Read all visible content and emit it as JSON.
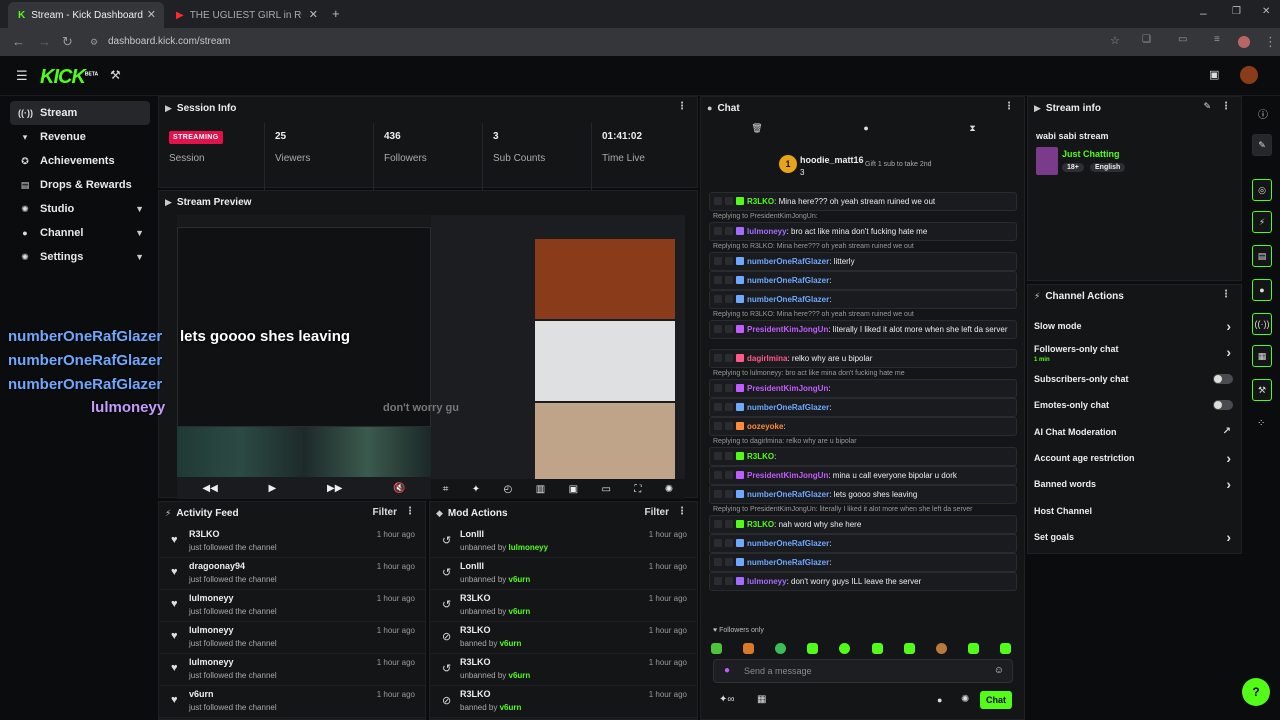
{
  "browser": {
    "tabs": [
      {
        "label": "Stream - Kick Dashboard"
      },
      {
        "label": "THE UGLIEST GIRL in ROBLOX"
      }
    ],
    "url": "dashboard.kick.com/stream"
  },
  "brand": {
    "logo": "KICK",
    "beta": "BETA",
    "accent": "#53fc18"
  },
  "sidebar": {
    "items": [
      {
        "label": "Stream",
        "icon": "broadcast-icon"
      },
      {
        "label": "Revenue",
        "icon": "trophy-icon"
      },
      {
        "label": "Achievements",
        "icon": "award-icon"
      },
      {
        "label": "Drops & Rewards",
        "icon": "gift-icon"
      },
      {
        "label": "Studio",
        "icon": "gear-icon"
      },
      {
        "label": "Channel",
        "icon": "user-icon"
      },
      {
        "label": "Settings",
        "icon": "gear-icon"
      }
    ]
  },
  "session": {
    "title": "Session Info",
    "status": "STREAMING",
    "status_label": "Session",
    "stats": [
      {
        "value": "25",
        "label": "Viewers"
      },
      {
        "value": "436",
        "label": "Followers"
      },
      {
        "value": "3",
        "label": "Sub Counts"
      },
      {
        "value": "01:41:02",
        "label": "Time Live"
      }
    ]
  },
  "preview": {
    "title": "Stream Preview",
    "overlay_names": [
      "numberOneRafGlazer",
      "numberOneRafGlazer",
      "numberOneRafGlazer",
      "lulmoneyy"
    ],
    "overlay_msg": "lets goooo shes leaving",
    "overlay_msg2": "don't worry gu"
  },
  "activity": {
    "title": "Activity Feed",
    "filter": "Filter",
    "rows": [
      {
        "name": "R3LKO",
        "desc": "just followed the channel",
        "time": "1 hour ago"
      },
      {
        "name": "dragoonay94",
        "desc": "just followed the channel",
        "time": "1 hour ago"
      },
      {
        "name": "lulmoneyy",
        "desc": "just followed the channel",
        "time": "1 hour ago"
      },
      {
        "name": "lulmoneyy",
        "desc": "just followed the channel",
        "time": "1 hour ago"
      },
      {
        "name": "lulmoneyy",
        "desc": "just followed the channel",
        "time": "1 hour ago"
      },
      {
        "name": "v6urn",
        "desc": "just followed the channel",
        "time": "1 hour ago"
      }
    ]
  },
  "mod": {
    "title": "Mod Actions",
    "filter": "Filter",
    "rows": [
      {
        "name": "Lonlll",
        "action": "unbanned by",
        "by": "lulmoneyy",
        "time": "1 hour ago"
      },
      {
        "name": "Lonlll",
        "action": "unbanned by",
        "by": "v6urn",
        "time": "1 hour ago"
      },
      {
        "name": "R3LKO",
        "action": "unbanned by",
        "by": "v6urn",
        "time": "1 hour ago"
      },
      {
        "name": "R3LKO",
        "action": "banned by",
        "by": "v6urn",
        "time": "1 hour ago"
      },
      {
        "name": "R3LKO",
        "action": "unbanned by",
        "by": "v6urn",
        "time": "1 hour ago"
      },
      {
        "name": "R3LKO",
        "action": "banned by",
        "by": "v6urn",
        "time": "1 hour ago"
      }
    ]
  },
  "chat": {
    "title": "Chat",
    "pinned_user": "hoodie_matt16",
    "pinned_count": "3",
    "pinned_rank": "1",
    "gift_text": "Gift 1 sub to take 2nd",
    "followers_only": "Followers only",
    "placeholder": "Send a message",
    "send": "Chat",
    "messages": [
      {
        "reply": "",
        "user": "R3LKO",
        "color": "#53fc18",
        "text": ": Mina here??? oh yeah stream ruined we out"
      },
      {
        "reply": "Replying to PresidentKimJongUn:",
        "user": "lulmoneyy",
        "color": "#a36cff",
        "text": ": bro act like mina don't fucking hate me"
      },
      {
        "reply": "Replying to R3LKO: Mina here??? oh yeah stream ruined we out",
        "user": "numberOneRafGlazer",
        "color": "#6ea8ff",
        "text": ": litterly"
      },
      {
        "reply": "",
        "user": "numberOneRafGlazer",
        "color": "#6ea8ff",
        "text": ":"
      },
      {
        "reply": "",
        "user": "numberOneRafGlazer",
        "color": "#6ea8ff",
        "text": ":"
      },
      {
        "reply": "Replying to R3LKO: Mina here??? oh yeah stream ruined we out",
        "user": "PresidentKimJongUn",
        "color": "#c35cff",
        "text": ": literally I liked it alot more when she left da server"
      },
      {
        "reply": "",
        "user": "dagirlmina",
        "color": "#ff5a8a",
        "text": ": relko why are u bipolar"
      },
      {
        "reply": "Replying to lulmoneyy: bro act like mina don't fucking hate me",
        "user": "PresidentKimJongUn",
        "color": "#c35cff",
        "text": ":"
      },
      {
        "reply": "",
        "user": "numberOneRafGlazer",
        "color": "#6ea8ff",
        "text": ":"
      },
      {
        "reply": "",
        "user": "oozeyoke",
        "color": "#ff8c3b",
        "text": ":"
      },
      {
        "reply": "Replying to dagirlmina: relko why are u bipolar",
        "user": "R3LKO",
        "color": "#53fc18",
        "text": ":"
      },
      {
        "reply": "",
        "user": "PresidentKimJongUn",
        "color": "#c35cff",
        "text": ": mina u call everyone bipolar u dork"
      },
      {
        "reply": "",
        "user": "numberOneRafGlazer",
        "color": "#6ea8ff",
        "text": ": lets goooo shes leaving"
      },
      {
        "reply": "Replying to PresidentKimJongUn: literally I liked it alot more when she left da server",
        "user": "R3LKO",
        "color": "#53fc18",
        "text": ": nah word why she here"
      },
      {
        "reply": "",
        "user": "numberOneRafGlazer",
        "color": "#6ea8ff",
        "text": ":"
      },
      {
        "reply": "",
        "user": "numberOneRafGlazer",
        "color": "#6ea8ff",
        "text": ":"
      },
      {
        "reply": "",
        "user": "lulmoneyy",
        "color": "#a36cff",
        "text": ": don't worry guys ILL leave the server"
      }
    ]
  },
  "stream_info": {
    "title": "Stream info",
    "stream_title": "wabi sabi stream",
    "category": "Just Chatting",
    "tags": [
      "18+",
      "English"
    ]
  },
  "actions": {
    "title": "Channel Actions",
    "rows": [
      {
        "label": "Slow mode",
        "type": "chev",
        "sub": ""
      },
      {
        "label": "Followers-only chat",
        "type": "chev",
        "sub": "1 min"
      },
      {
        "label": "Subscribers-only chat",
        "type": "toggle",
        "sub": ""
      },
      {
        "label": "Emotes-only chat",
        "type": "toggle",
        "sub": ""
      },
      {
        "label": "AI Chat Moderation",
        "type": "ext",
        "sub": ""
      },
      {
        "label": "Account age restriction",
        "type": "chev",
        "sub": ""
      },
      {
        "label": "Banned words",
        "type": "chev",
        "sub": ""
      },
      {
        "label": "Host Channel",
        "type": "none",
        "sub": ""
      },
      {
        "label": "Set goals",
        "type": "chev",
        "sub": ""
      }
    ]
  }
}
